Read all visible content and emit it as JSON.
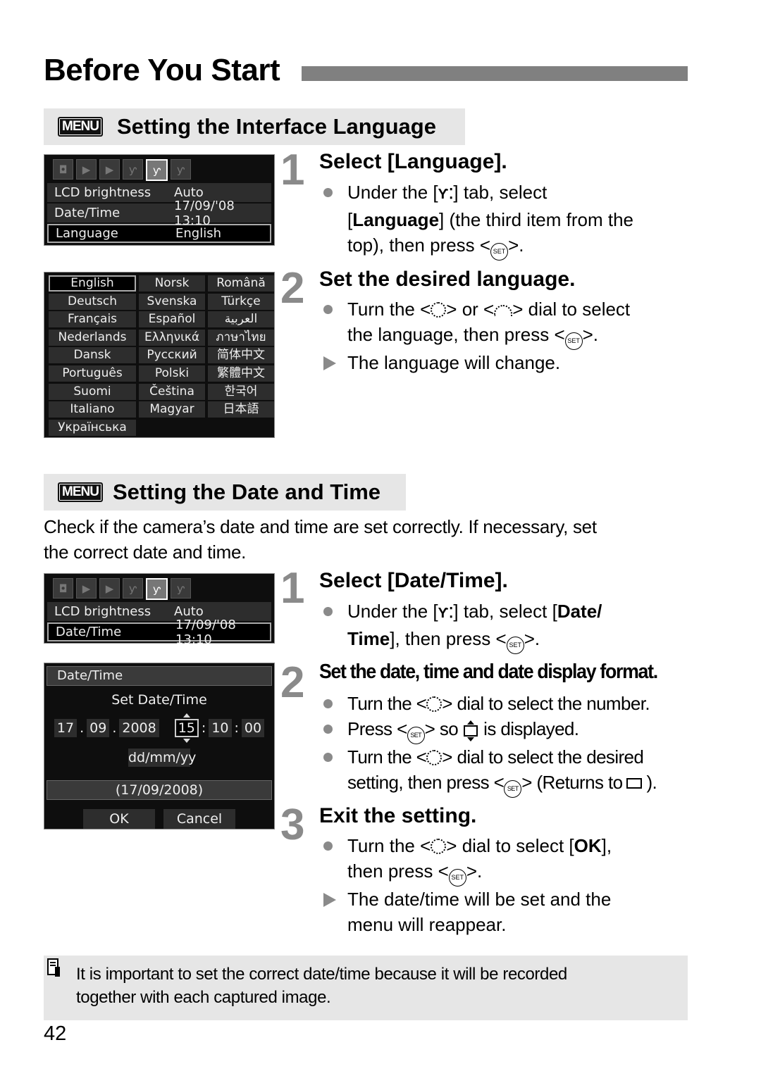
{
  "page": {
    "title": "Before You Start",
    "page_number": "42",
    "accent_color": "#808080",
    "section_bg_color": "#e6e6e6"
  },
  "section1": {
    "badge": "MENU",
    "title": "Setting the Interface Language",
    "screen1": {
      "tabs": [
        "camera-tab",
        "playback-tab-1",
        "playback-tab-2",
        "setup-tab-1",
        "setup-tab-2",
        "setup-tab-3"
      ],
      "active_tab": "setup-tab-2",
      "rows": [
        {
          "label": "LCD brightness",
          "value": "Auto"
        },
        {
          "label": "Date/Time",
          "value": "17/09/'08 13:10"
        },
        {
          "label": "Language",
          "value": "English",
          "selected": true
        }
      ]
    },
    "screen2": {
      "languages": [
        "English",
        "Norsk",
        "Română",
        "Deutsch",
        "Svenska",
        "Türkçe",
        "Français",
        "Español",
        "العربية",
        "Nederlands",
        "Ελληνικά",
        "ภาษาไทย",
        "Dansk",
        "Русский",
        "简体中文",
        "Português",
        "Polski",
        "繁體中文",
        "Suomi",
        "Čeština",
        "한국어",
        "Italiano",
        "Magyar",
        "日本語",
        "Українська"
      ],
      "selected": "English"
    },
    "steps": [
      {
        "number": "1",
        "title": "Select [Language].",
        "lines": {
          "b1_a": "Under the [",
          "b1_b": "] tab, select",
          "b1_c": "Language",
          "b1_d": "] (the third item from the",
          "b1_e": "top), then press <",
          "b1_f": ">."
        }
      },
      {
        "number": "2",
        "title": "Set the desired language.",
        "lines": {
          "b1_a": "Turn the <",
          "b1_b": "> or <",
          "b1_c": "> dial to select",
          "b1_d": "the language, then press <",
          "b1_e": ">.",
          "r1": "The language will change."
        }
      }
    ]
  },
  "section2": {
    "badge": "MENU",
    "title": "Setting the Date and Time",
    "intro_line1": "Check if the camera’s date and time are set correctly. If necessary, set",
    "intro_line2": "the correct date and time.",
    "screen1": {
      "rows": [
        {
          "label": "LCD brightness",
          "value": "Auto"
        },
        {
          "label": "Date/Time",
          "value": "17/09/'08 13:10",
          "selected": true
        }
      ]
    },
    "screen2": {
      "header": "Date/Time",
      "subtitle": "Set Date/Time",
      "day": "17",
      "month": "09",
      "year": "2008",
      "hour": "15",
      "minute": "10",
      "second": "00",
      "format": "dd/mm/yy",
      "preview": "(17/09/2008)",
      "ok": "OK",
      "cancel": "Cancel"
    },
    "steps": [
      {
        "number": "1",
        "title": "Select [Date/Time].",
        "lines": {
          "b1_a": "Under the [",
          "b1_b": "] tab, select [",
          "b1_c": "Date/",
          "b1_d": "Time",
          "b1_e": "], then press <",
          "b1_f": ">."
        }
      },
      {
        "number": "2",
        "title": "Set the date, time and date display format.",
        "lines": {
          "b1_a": "Turn the <",
          "b1_b": "> dial to select the number.",
          "b2_a": "Press <",
          "b2_b": "> so",
          "b2_c": "is displayed.",
          "b3_a": "Turn the <",
          "b3_b": "> dial to select the desired",
          "b3_c": "setting, then press <",
          "b3_d": "> (Returns to",
          "b3_e": ")."
        }
      },
      {
        "number": "3",
        "title": "Exit the setting.",
        "lines": {
          "b1_a": "Turn the <",
          "b1_b": "> dial to select [",
          "b1_c": "OK",
          "b1_d": "],",
          "b1_e": "then press <",
          "b1_f": ">.",
          "r1_a": "The date/time will be set and the",
          "r1_b": "menu will reappear."
        }
      }
    ]
  },
  "note": {
    "line1": "It is important to set the correct date/time because it will be recorded",
    "line2": "together with each captured image."
  },
  "icons": {
    "set_label": "SET",
    "wrench_glyph": "🔧",
    "wrench_text": "Ƴ⁚"
  }
}
